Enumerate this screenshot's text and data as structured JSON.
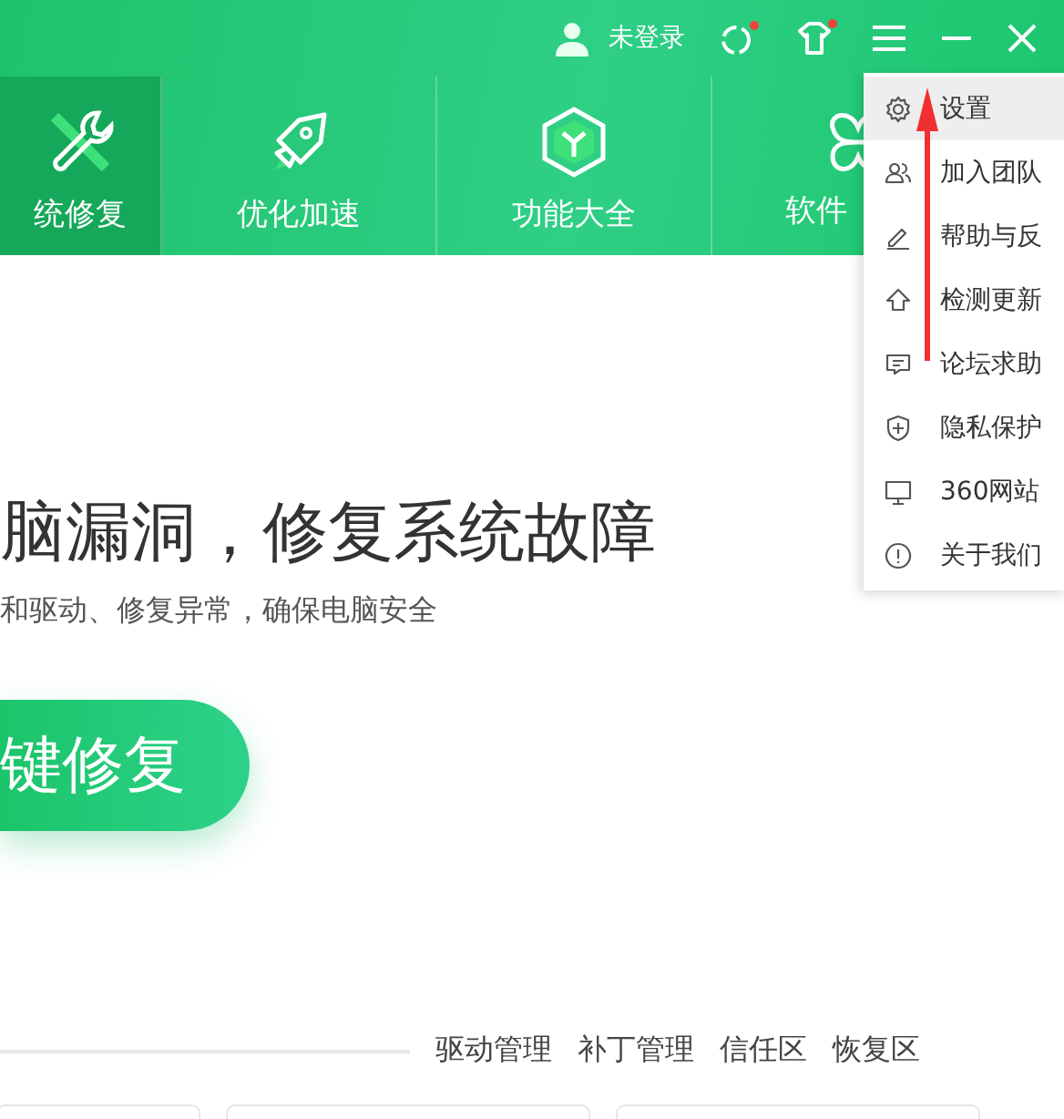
{
  "top_bar": {
    "user_label": "未登录"
  },
  "nav_tabs": [
    {
      "label": "统修复",
      "kind": "repair",
      "selected": true
    },
    {
      "label": "优化加速",
      "kind": "rocket",
      "selected": false
    },
    {
      "label": "功能大全",
      "kind": "hexagon",
      "selected": false
    },
    {
      "label": "软件",
      "kind": "clover",
      "selected": false
    }
  ],
  "hero": {
    "title": "脑漏洞，修复系统故障",
    "subtitle": "和驱动、修复异常，确保电脑安全",
    "button": "键修复"
  },
  "bottom_links": [
    "驱动管理",
    "补丁管理",
    "信任区",
    "恢复区"
  ],
  "menu": [
    {
      "label": "设置",
      "kind": "gear",
      "selected": true
    },
    {
      "label": "加入团队",
      "kind": "people",
      "selected": false
    },
    {
      "label": "帮助与反",
      "kind": "pen",
      "selected": false
    },
    {
      "label": "检测更新",
      "kind": "up",
      "selected": false
    },
    {
      "label": "论坛求助",
      "kind": "chat",
      "selected": false
    },
    {
      "label": "隐私保护",
      "kind": "shield",
      "selected": false
    },
    {
      "label": "360网站",
      "kind": "monitor",
      "selected": false
    },
    {
      "label": "关于我们",
      "kind": "info",
      "selected": false
    }
  ]
}
